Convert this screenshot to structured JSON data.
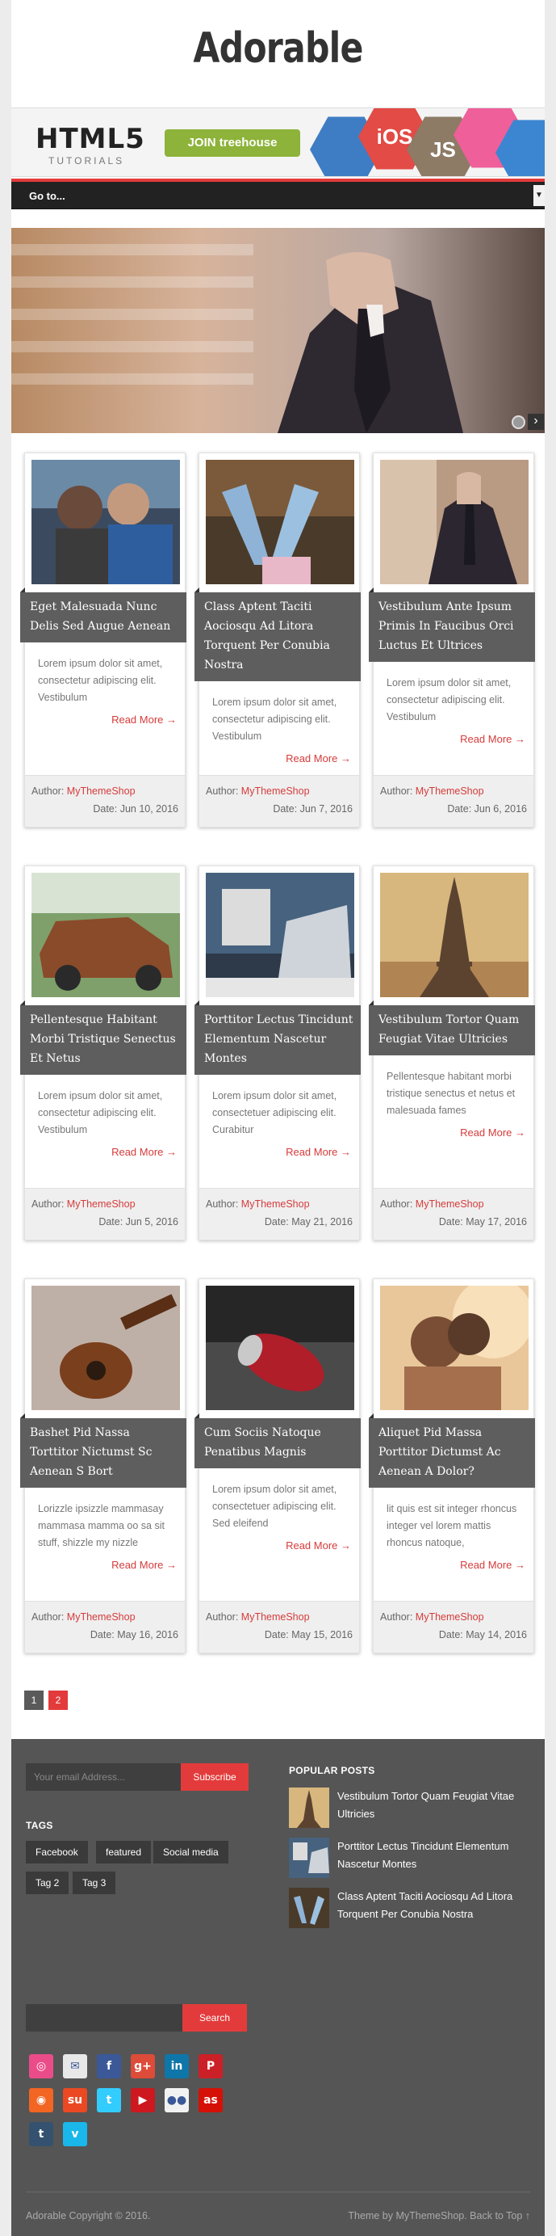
{
  "site": {
    "title": "Adorable"
  },
  "banner": {
    "brand": "HTML5",
    "sub": "TUTORIALS",
    "cta": "JOIN treehouse",
    "badges": [
      "iOS",
      "JS"
    ]
  },
  "nav": {
    "label": "Go to...",
    "arrow": "▼"
  },
  "slider": {
    "next": "›"
  },
  "posts": [
    {
      "title": "Eget Malesuada Nunc Delis Sed Augue Aenean",
      "excerpt": "Lorem ipsum dolor sit amet, consectetur adipiscing elit. Vestibulum",
      "more": "Read More →",
      "author_label": "Author: ",
      "author": "MyThemeShop",
      "date": "Date: Jun 10, 2016"
    },
    {
      "title": "Class Aptent Taciti Aociosqu Ad Litora Torquent Per Conubia Nostra",
      "excerpt": "Lorem ipsum dolor sit amet, consectetur adipiscing elit. Vestibulum",
      "more": "Read More →",
      "author_label": "Author: ",
      "author": "MyThemeShop",
      "date": "Date: Jun 7, 2016"
    },
    {
      "title": "Vestibulum Ante Ipsum Primis In Faucibus Orci Luctus Et Ultrices",
      "excerpt": "Lorem ipsum dolor sit amet, consectetur adipiscing elit. Vestibulum",
      "more": "Read More →",
      "author_label": "Author: ",
      "author": "MyThemeShop",
      "date": "Date: Jun 6, 2016"
    },
    {
      "title": "Pellentesque Habitant Morbi Tristique Senectus Et Netus",
      "excerpt": "Lorem ipsum dolor sit amet, consectetur adipiscing elit. Vestibulum",
      "more": "Read More →",
      "author_label": "Author: ",
      "author": "MyThemeShop",
      "date": "Date: Jun 5, 2016"
    },
    {
      "title": "Porttitor Lectus Tincidunt Elementum Nascetur Montes",
      "excerpt": "Lorem ipsum dolor sit amet, consectetuer adipiscing elit. Curabitur",
      "more": "Read More →",
      "author_label": "Author: ",
      "author": "MyThemeShop",
      "date": "Date: May 21, 2016"
    },
    {
      "title": "Vestibulum Tortor Quam Feugiat Vitae Ultricies",
      "excerpt": "Pellentesque habitant morbi tristique senectus et netus et malesuada fames",
      "more": "Read More →",
      "author_label": "Author: ",
      "author": "MyThemeShop",
      "date": "Date: May 17, 2016"
    },
    {
      "title": "Bashet Pid Nassa Torttitor Nictumst Sc Aenean S Bort",
      "excerpt": "Lorizzle ipsizzle mammasay mammasa mamma oo sa sit stuff, shizzle my nizzle",
      "more": "Read More →",
      "author_label": "Author: ",
      "author": "MyThemeShop",
      "date": "Date: May 16, 2016"
    },
    {
      "title": "Cum Sociis Natoque Penatibus Magnis",
      "excerpt": "Lorem ipsum dolor sit amet, consectetuer adipiscing elit. Sed eleifend",
      "more": "Read More →",
      "author_label": "Author: ",
      "author": "MyThemeShop",
      "date": "Date: May 15, 2016"
    },
    {
      "title": "Aliquet Pid Massa Porttitor Dictumst Ac Aenean A Dolor?",
      "excerpt": "lit quis est sit integer rhoncus integer vel lorem mattis rhoncus natoque,",
      "more": "Read More →",
      "author_label": "Author: ",
      "author": "MyThemeShop",
      "date": "Date: May 14, 2016"
    }
  ],
  "pagination": {
    "pages": [
      "1",
      "2"
    ],
    "current": "2"
  },
  "footer": {
    "email_placeholder": "Your email Address...",
    "subscribe": "Subscribe",
    "tags_title": "TAGS",
    "tags": [
      "Facebook",
      "featured",
      "Social media",
      "Tag 2",
      "Tag 3"
    ],
    "search_button": "Search",
    "popular_title": "POPULAR POSTS",
    "popular": [
      "Vestibulum Tortor Quam Feugiat Vitae Ultricies",
      "Porttitor Lectus Tincidunt Elementum Nascetur Montes",
      "Class Aptent Taciti Aociosqu Ad Litora Torquent Per Conubia Nostra"
    ],
    "social": [
      {
        "name": "dribbble-icon",
        "color": "#ea4c89",
        "glyph": "◎"
      },
      {
        "name": "email-icon",
        "color": "#e8e8e8",
        "glyph": "✉"
      },
      {
        "name": "facebook-icon",
        "color": "#3b5998",
        "glyph": "f"
      },
      {
        "name": "google-plus-icon",
        "color": "#dd4b39",
        "glyph": "g+"
      },
      {
        "name": "linkedin-icon",
        "color": "#0e76a8",
        "glyph": "in"
      },
      {
        "name": "pinterest-icon",
        "color": "#cb2027",
        "glyph": "P"
      },
      {
        "name": "rss-icon",
        "color": "#f26522",
        "glyph": "◉"
      },
      {
        "name": "stumbleupon-icon",
        "color": "#eb4924",
        "glyph": "su"
      },
      {
        "name": "twitter-icon",
        "color": "#33ccff",
        "glyph": "t"
      },
      {
        "name": "youtube-icon",
        "color": "#cc181e",
        "glyph": "▶"
      },
      {
        "name": "flickr-icon",
        "color": "#f2f2f2",
        "glyph": "●●"
      },
      {
        "name": "lastfm-icon",
        "color": "#d51007",
        "glyph": "as"
      },
      {
        "name": "tumblr-icon",
        "color": "#34526f",
        "glyph": "t"
      },
      {
        "name": "vimeo-icon",
        "color": "#1ab7ea",
        "glyph": "v"
      }
    ],
    "copyright": "Adorable Copyright © 2016.",
    "credit": "Theme by MyThemeShop. Back to Top ↑"
  },
  "colors": {
    "accent": "#e33b3b",
    "footer_bg": "#555555",
    "title_bar": "#5e5e5e"
  }
}
